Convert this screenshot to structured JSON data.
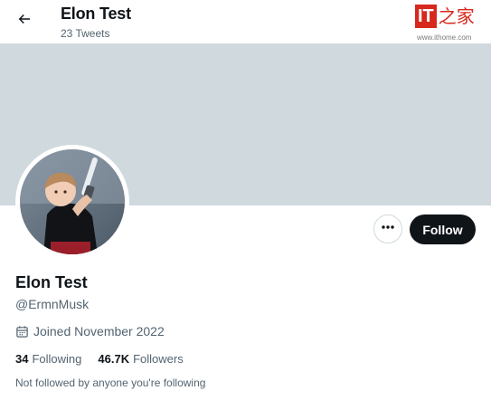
{
  "header": {
    "title": "Elon Test",
    "tweet_count": "23 Tweets"
  },
  "watermark": {
    "logo_text": "IT",
    "logo_chinese": "之家",
    "url": "www.ithome.com"
  },
  "profile": {
    "display_name": "Elon Test",
    "handle": "@ErmnMusk",
    "joined": "Joined November 2022",
    "following_count": "34",
    "following_label": "Following",
    "followers_count": "46.7K",
    "followers_label": "Followers",
    "followed_by_text": "Not followed by anyone you're following"
  },
  "actions": {
    "follow_label": "Follow"
  },
  "icons": {
    "back": "arrow-left-icon",
    "more": "more-dots-icon",
    "calendar": "calendar-icon"
  },
  "colors": {
    "banner": "#cfd9de",
    "follow_button": "#0f1419",
    "secondary_text": "#536471",
    "watermark_red": "#d7281e"
  }
}
